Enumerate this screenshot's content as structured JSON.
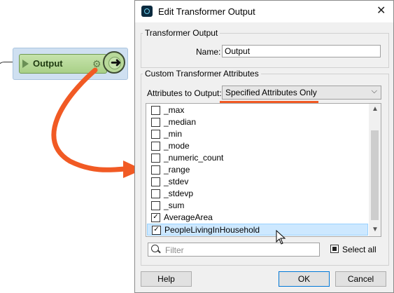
{
  "canvas": {
    "node_label": "Output",
    "accent_orange": "#f15a24"
  },
  "dialog": {
    "title": "Edit Transformer Output",
    "group_output": {
      "title": "Transformer Output",
      "name_label": "Name:",
      "name_value": "Output"
    },
    "group_attrs": {
      "title": "Custom Transformer Attributes",
      "attrs_label": "Attributes to Output:",
      "attrs_value": "Specified Attributes Only"
    },
    "attributes": [
      {
        "label": "_max",
        "checked": false
      },
      {
        "label": "_median",
        "checked": false
      },
      {
        "label": "_min",
        "checked": false
      },
      {
        "label": "_mode",
        "checked": false
      },
      {
        "label": "_numeric_count",
        "checked": false
      },
      {
        "label": "_range",
        "checked": false
      },
      {
        "label": "_stdev",
        "checked": false
      },
      {
        "label": "_stdevp",
        "checked": false
      },
      {
        "label": "_sum",
        "checked": false
      },
      {
        "label": "AverageArea",
        "checked": true
      },
      {
        "label": "PeopleLivingInHousehold",
        "checked": true
      }
    ],
    "filter_placeholder": "Filter",
    "select_all_label": "Select all",
    "buttons": {
      "help": "Help",
      "ok": "OK",
      "cancel": "Cancel"
    }
  }
}
